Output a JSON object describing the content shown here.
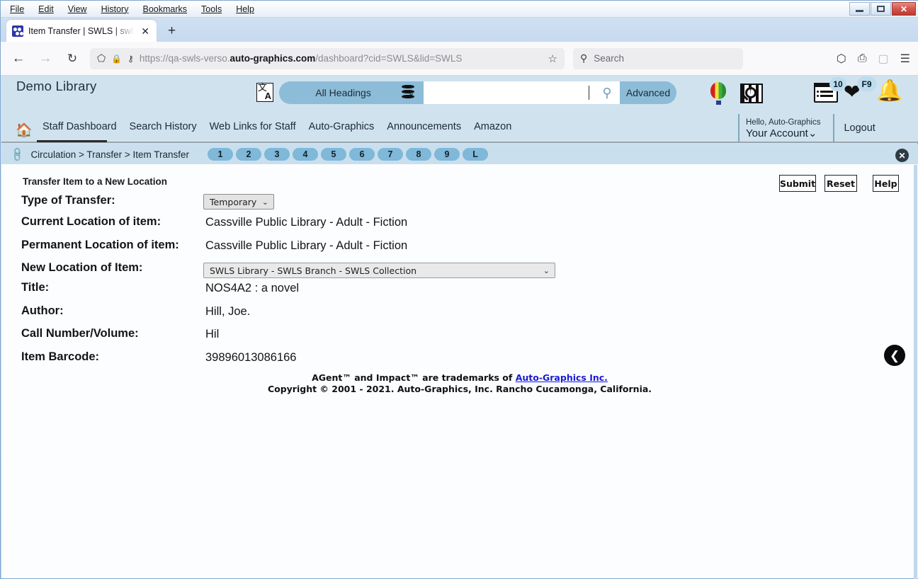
{
  "browser": {
    "menus": [
      "File",
      "Edit",
      "View",
      "History",
      "Bookmarks",
      "Tools",
      "Help"
    ],
    "window_controls": {
      "minimize": "–",
      "maximize": "□",
      "close": "✕"
    },
    "tab": {
      "title": "Item Transfer | SWLS | swls | Aut",
      "close": "✕",
      "favicon": "page-favicon"
    },
    "new_tab": "+",
    "toolbar": {
      "back": "←",
      "forward": "→",
      "reload": "↻",
      "shield_icon": "⬠",
      "lock_icon": "🔒",
      "permissions_icon": "⚷",
      "url_prefix": "https://qa-swls-verso.",
      "url_domain": "auto-graphics.com",
      "url_suffix": "/dashboard?cid=SWLS&lid=SWLS",
      "star": "☆",
      "search_placeholder": "Search",
      "search_icon": "⚲",
      "pocket_icon": "⬡",
      "print_icon": "⎙",
      "account_icon": "▢",
      "hamburger": "☰"
    }
  },
  "app": {
    "library_name": "Demo Library",
    "search_bar": {
      "translate_icon_cn": "文",
      "translate_icon_a": "A",
      "scope_label": "All Headings",
      "caret": "⌄",
      "database_icon": "database-icon",
      "query": "",
      "search_icon": "⚲",
      "advanced_label": "Advanced"
    },
    "header_icons": {
      "balloon": "balloon-icon",
      "film_search": "film-search-icon",
      "list_badge": "10",
      "heart_badge": "F9",
      "bell": "bell-icon"
    },
    "nav": {
      "home_icon": "🏠",
      "items": [
        "Staff Dashboard",
        "Search History",
        "Web Links for Staff",
        "Auto-Graphics",
        "Announcements",
        "Amazon"
      ],
      "active": "Staff Dashboard"
    },
    "account": {
      "greeting": "Hello, Auto-Graphics",
      "name": "Your Account",
      "caret": "⌄",
      "logout": "Logout"
    },
    "breadcrumb": {
      "chain_icon": "⚭",
      "text": "Circulation > Transfer > Item Transfer",
      "pages": [
        "1",
        "2",
        "3",
        "4",
        "5",
        "6",
        "7",
        "8",
        "9",
        "L"
      ],
      "close": "✕"
    }
  },
  "form": {
    "title": "Transfer Item to a New Location",
    "buttons": {
      "submit": "Submit",
      "reset": "Reset",
      "help": "Help"
    },
    "fields": [
      {
        "label": "Type of Transfer:",
        "value": "Temporary",
        "type": "select-small"
      },
      {
        "label": "Current Location of item:",
        "value": "Cassville Public Library - Adult - Fiction",
        "type": "text"
      },
      {
        "label": "Permanent Location of item:",
        "value": "Cassville Public Library - Adult - Fiction",
        "type": "text"
      },
      {
        "label": "New Location of Item:",
        "value": "SWLS Library - SWLS Branch - SWLS Collection",
        "type": "select-wide"
      },
      {
        "label": "Title:",
        "value": "NOS4A2 : a novel",
        "type": "text"
      },
      {
        "label": "Author:",
        "value": "Hill, Joe.",
        "type": "text"
      },
      {
        "label": "Call Number/Volume:",
        "value": "Hil",
        "type": "text"
      },
      {
        "label": "Item Barcode:",
        "value": "39896013086166",
        "type": "text"
      }
    ],
    "back_button_icon": "❮"
  },
  "footer": {
    "line1_pre": "AGent™ and Impact™ are trademarks of ",
    "line1_link": "Auto-Graphics Inc.",
    "line2": "Copyright © 2001 - 2021. Auto-Graphics, Inc. Rancho Cucamonga, California."
  },
  "colors": {
    "app_header_bg": "#cfe2ee",
    "breadcrumb_bg": "#c9dfed",
    "accent_blue": "#8cbcd8",
    "page_pill": "#7fb8d8",
    "content_bg": "#fbfdff",
    "link": "#1a1ad0",
    "close_btn_red": "#bb3a31"
  }
}
